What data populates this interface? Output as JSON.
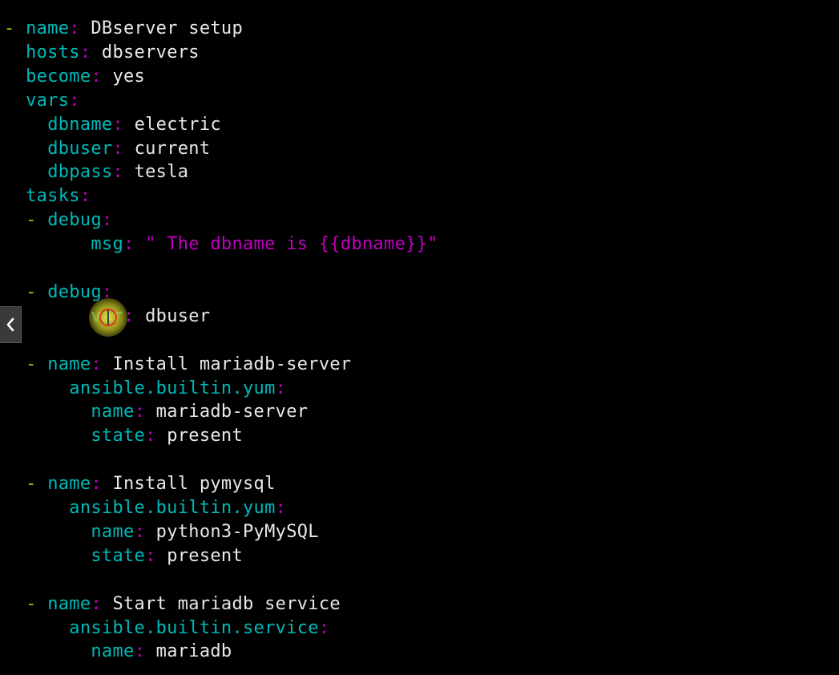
{
  "document_marker": "---",
  "lines": [
    {
      "indent": "",
      "dash": "-",
      "key": "name",
      "value": "DBserver setup"
    },
    {
      "indent": "  ",
      "key": "hosts",
      "value": "dbservers"
    },
    {
      "indent": "  ",
      "key": "become",
      "value": "yes"
    },
    {
      "indent": "  ",
      "key": "vars",
      "value": ""
    },
    {
      "indent": "    ",
      "key": "dbname",
      "value": "electric"
    },
    {
      "indent": "    ",
      "key": "dbuser",
      "value": "current"
    },
    {
      "indent": "    ",
      "key": "dbpass",
      "value": "tesla"
    },
    {
      "indent": "  ",
      "key": "tasks",
      "value": ""
    },
    {
      "indent": "    ",
      "dash": "-",
      "key": "debug",
      "value": ""
    },
    {
      "indent": "        ",
      "key": "msg",
      "string": "\" The dbname is {{dbname}}\""
    },
    {
      "blank": true
    },
    {
      "indent": "    ",
      "dash": "-",
      "key": "debug",
      "value": ""
    },
    {
      "indent": "        ",
      "key": "var",
      "value": "dbuser"
    },
    {
      "blank": true
    },
    {
      "indent": "    ",
      "dash": "-",
      "key": "name",
      "value": "Install mariadb-server"
    },
    {
      "indent": "      ",
      "key": "ansible.builtin.yum",
      "value": ""
    },
    {
      "indent": "        ",
      "key": "name",
      "value": "mariadb-server"
    },
    {
      "indent": "        ",
      "key": "state",
      "value": "present"
    },
    {
      "blank": true
    },
    {
      "indent": "    ",
      "dash": "-",
      "key": "name",
      "value": "Install pymysql"
    },
    {
      "indent": "      ",
      "key": "ansible.builtin.yum",
      "value": ""
    },
    {
      "indent": "        ",
      "key": "name",
      "value": "python3-PyMySQL"
    },
    {
      "indent": "        ",
      "key": "state",
      "value": "present"
    },
    {
      "blank": true
    },
    {
      "indent": "    ",
      "dash": "-",
      "key": "name",
      "value": "Start mariadb service"
    },
    {
      "indent": "      ",
      "key": "ansible.builtin.service",
      "value": ""
    },
    {
      "indent": "        ",
      "key": "name",
      "value": "mariadb"
    }
  ],
  "icons": {
    "side_toggle": "chevron-left-icon"
  },
  "colors": {
    "background": "#000000",
    "key": "#00b8b8",
    "dash": "#b5b500",
    "punctuation": "#c000c0",
    "string": "#c000c0",
    "value": "#e8e8e8",
    "doc_marker": "#2f3fd0"
  }
}
